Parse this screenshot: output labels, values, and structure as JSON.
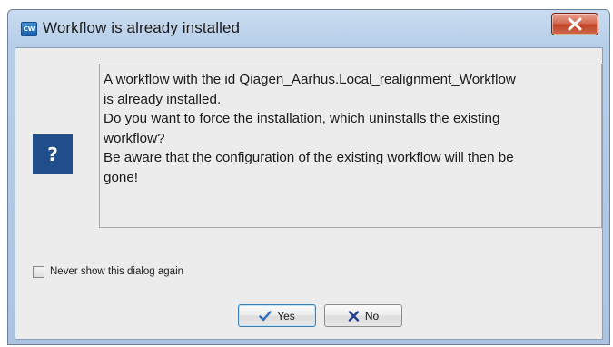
{
  "window": {
    "title": "Workflow is already installed",
    "app_icon_text": "CW",
    "icon": "question-icon",
    "icon_glyph": "?"
  },
  "message": {
    "lines": [
      "A workflow with the id Qiagen_Aarhus.Local_realignment_Workflow",
      "is already installed.",
      "Do you want to force the installation, which uninstalls the existing",
      "workflow?",
      "Be aware that the configuration of the existing workflow will then be",
      "gone!"
    ]
  },
  "options": {
    "never_show_label": "Never show this dialog again",
    "never_show_checked": false
  },
  "buttons": {
    "yes_label": "Yes",
    "no_label": "No",
    "yes_icon": "check-icon",
    "no_icon": "x-icon"
  },
  "colors": {
    "accent": "#1f4e8a",
    "close_button": "#c24328",
    "check_mark": "#2a6fb5",
    "x_mark": "#1f3f8a"
  }
}
